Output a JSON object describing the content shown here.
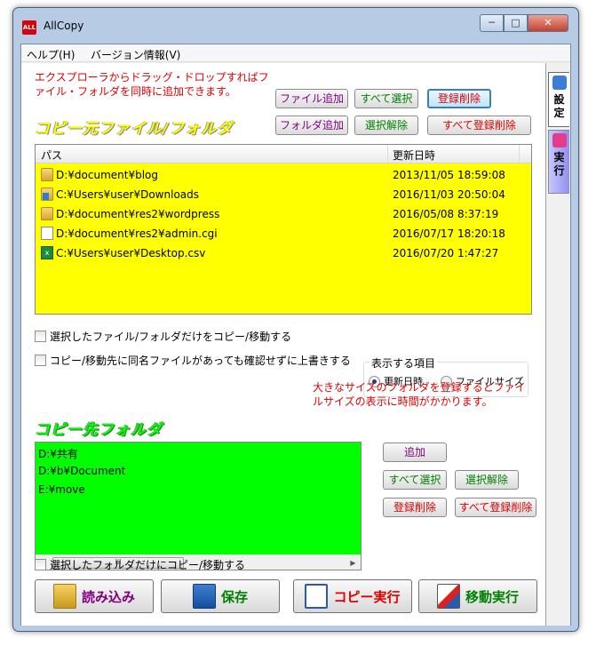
{
  "window": {
    "title": "AllCopy",
    "app_icon_label": "ALL",
    "min_glyph": "─",
    "max_glyph": "□",
    "close_glyph": "✕"
  },
  "menu": {
    "help": "ヘルプ(H)",
    "version": "バージョン情報(V)"
  },
  "side_tabs": {
    "settings": "設定",
    "run": "実行",
    "settings_icon": "gear-icon",
    "run_icon": "runner-icon"
  },
  "source": {
    "notice_line1": "エクスプローラからドラッグ・ドロップすればフ",
    "notice_line2": "ァイル・フォルダを同時に追加できます。",
    "heading": "コピー元ファイル/フォルダ",
    "buttons": {
      "add_file": "ファイル追加",
      "select_all": "すべて選択",
      "delete": "登録削除",
      "add_folder": "フォルダ追加",
      "deselect": "選択解除",
      "delete_all": "すべて登録削除"
    },
    "columns": {
      "path": "パス",
      "updated": "更新日時"
    },
    "rows": [
      {
        "icon": "folder-icon",
        "path": "D:¥document¥blog",
        "date": "2013/11/05 18:59:08"
      },
      {
        "icon": "downloads-folder-icon",
        "path": "C:¥Users¥user¥Downloads",
        "date": "2016/11/03 20:50:04"
      },
      {
        "icon": "folder-icon",
        "path": "D:¥document¥res2¥wordpress",
        "date": "2016/05/08 8:37:19"
      },
      {
        "icon": "file-icon",
        "path": "D:¥document¥res2¥admin.cgi",
        "date": "2016/07/17 18:20:18"
      },
      {
        "icon": "csv-file-icon",
        "path": "C:¥Users¥user¥Desktop.csv",
        "date": "2016/07/20 1:47:27"
      }
    ]
  },
  "options": {
    "copy_selected_only": "選択したファイル/フォルダだけをコピー/移動する",
    "overwrite_without_confirm": "コピー/移動先に同名ファイルがあっても確認せずに上書きする",
    "display_group_label": "表示する項目",
    "radio_updated": "更新日時",
    "radio_filesize": "ファイルサイズ",
    "size_warning_line1": "大きなサイズのフォルダを登録するとファイ",
    "size_warning_line2": "ルサイズの表示に時間がかかります。"
  },
  "destination": {
    "heading": "コピー先フォルダ",
    "items": [
      "D:¥共有",
      "D:¥b¥Document",
      "E:¥move"
    ],
    "scroll_left": "◀",
    "scroll_right": "▶",
    "scroll_thumb": "III",
    "buttons": {
      "add": "追加",
      "select_all": "すべて選択",
      "deselect": "選択解除",
      "delete": "登録削除",
      "delete_all": "すべて登録削除"
    },
    "folder_selected_only": "選択したフォルダだけにコピー/移動する"
  },
  "actions": {
    "load": "読み込み",
    "save": "保存",
    "copy": "コピー実行",
    "move": "移動実行"
  },
  "colors": {
    "source_list_bg": "#ffff00",
    "dest_list_bg": "#00ff00",
    "notice_red": "#e00000",
    "label_purple": "#800080",
    "label_green": "#008000"
  }
}
